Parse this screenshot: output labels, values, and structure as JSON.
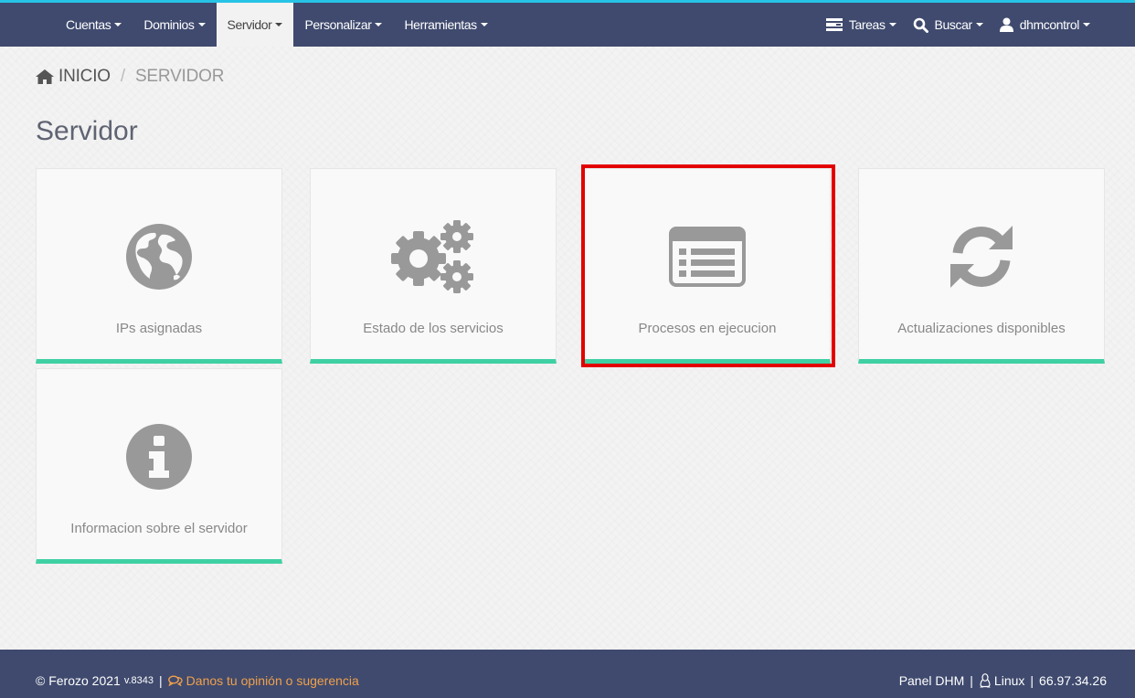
{
  "nav": {
    "items": [
      {
        "label": "Cuentas"
      },
      {
        "label": "Dominios"
      },
      {
        "label": "Servidor",
        "active": true
      },
      {
        "label": "Personalizar"
      },
      {
        "label": "Herramientas"
      }
    ],
    "right": {
      "tasks_label": "Tareas",
      "search_label": "Buscar",
      "user_label": "dhmcontrol"
    }
  },
  "breadcrumb": {
    "home": "INICIO",
    "separator": "/",
    "current": "SERVIDOR"
  },
  "page_title": "Servidor",
  "tiles": [
    {
      "label": "IPs asignadas",
      "icon": "globe-icon"
    },
    {
      "label": "Estado de los servicios",
      "icon": "gears-icon"
    },
    {
      "label": "Procesos en ejecucion",
      "icon": "list-icon"
    },
    {
      "label": "Actualizaciones disponibles",
      "icon": "refresh-icon"
    },
    {
      "label": "Informacion sobre el servidor",
      "icon": "info-icon"
    }
  ],
  "footer": {
    "copyright": "© Ferozo 2021",
    "version": "v.8343",
    "separator": "|",
    "feedback": "Danos tu opinión o sugerencia",
    "panel": "Panel DHM",
    "os": "Linux",
    "ip": "66.97.34.26"
  },
  "colors": {
    "nav_bg": "#3f4a6e",
    "nav_accent": "#27c3e6",
    "tile_accent": "#3fd0a3",
    "highlight": "#e30000",
    "feedback": "#f0a04b",
    "icon": "#999999"
  }
}
